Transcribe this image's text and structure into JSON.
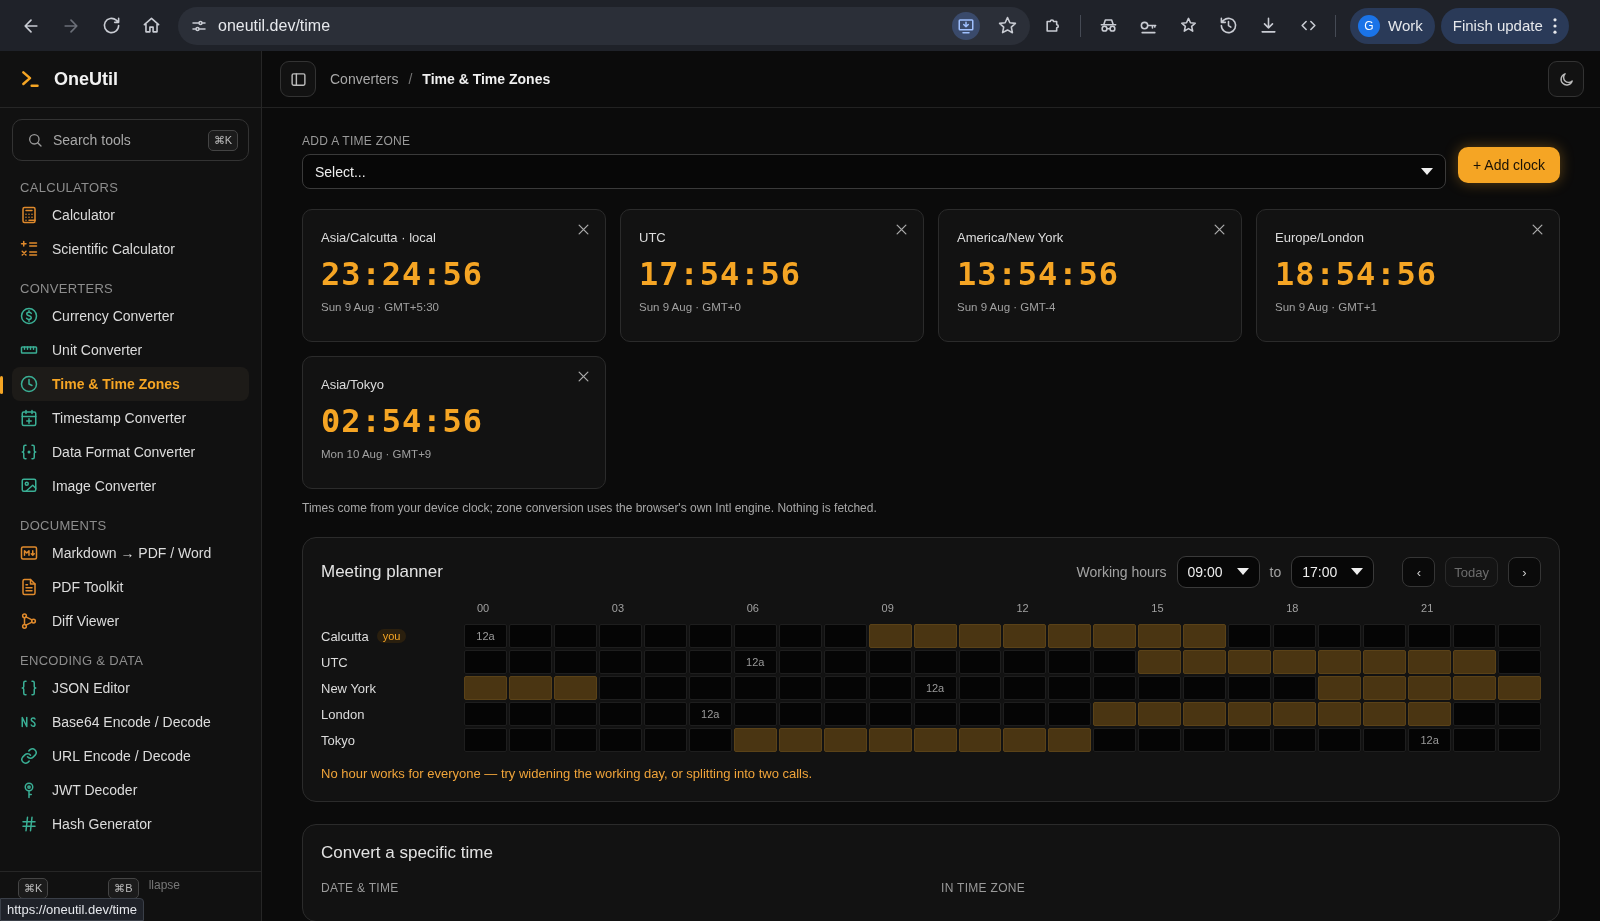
{
  "browser": {
    "url": "oneutil.dev/time",
    "profile": {
      "initial": "G",
      "name": "Work"
    },
    "update_button": "Finish update"
  },
  "sidebar": {
    "app_name": "OneUtil",
    "search": {
      "placeholder": "Search tools",
      "shortcut": "⌘K"
    },
    "sections": [
      {
        "title": "CALCULATORS",
        "items": [
          {
            "label": "Calculator",
            "selected": false
          },
          {
            "label": "Scientific Calculator",
            "selected": false
          }
        ]
      },
      {
        "title": "CONVERTERS",
        "items": [
          {
            "label": "Currency Converter",
            "selected": false
          },
          {
            "label": "Unit Converter",
            "selected": false
          },
          {
            "label": "Time & Time Zones",
            "selected": true
          },
          {
            "label": "Timestamp Converter",
            "selected": false
          },
          {
            "label": "Data Format Converter",
            "selected": false
          },
          {
            "label": "Image Converter",
            "selected": false
          }
        ]
      },
      {
        "title": "DOCUMENTS",
        "items": [
          {
            "label": "Markdown → PDF / Word",
            "selected": false
          },
          {
            "label": "PDF Toolkit",
            "selected": false
          },
          {
            "label": "Diff Viewer",
            "selected": false
          }
        ]
      },
      {
        "title": "ENCODING & DATA",
        "items": [
          {
            "label": "JSON Editor",
            "selected": false
          },
          {
            "label": "Base64 Encode / Decode",
            "selected": false
          },
          {
            "label": "URL Encode / Decode",
            "selected": false
          },
          {
            "label": "JWT Decoder",
            "selected": false
          },
          {
            "label": "Hash Generator",
            "selected": false
          }
        ]
      }
    ],
    "footer": {
      "keys": [
        "⌘K",
        "⌘B"
      ],
      "text": "llapse"
    }
  },
  "breadcrumb": {
    "items": [
      "Converters",
      "Time & Time Zones"
    ],
    "separator": "/"
  },
  "add_zone": {
    "label": "ADD A TIME ZONE",
    "value": "Select...",
    "button": "+ Add clock"
  },
  "clocks": [
    {
      "zone": "Asia/Calcutta · local",
      "time": "23:24:56",
      "date": "Sun 9 Aug · GMT+5:30"
    },
    {
      "zone": "UTC",
      "time": "17:54:56",
      "date": "Sun 9 Aug · GMT+0"
    },
    {
      "zone": "America/New York",
      "time": "13:54:56",
      "date": "Sun 9 Aug · GMT-4"
    },
    {
      "zone": "Europe/London",
      "time": "18:54:56",
      "date": "Sun 9 Aug · GMT+1"
    },
    {
      "zone": "Asia/Tokyo",
      "time": "02:54:56",
      "date": "Mon 10 Aug · GMT+9"
    }
  ],
  "note": "Times come from your device clock; zone conversion uses the browser's own Intl engine. Nothing is fetched.",
  "planner": {
    "title": "Meeting planner",
    "hours_label": "Working hours",
    "start": "09:00",
    "to": "to",
    "end": "17:00",
    "nav": [
      {
        "label": "‹",
        "disabled": false
      },
      {
        "label": "Today",
        "disabled": true
      },
      {
        "label": "›",
        "disabled": false
      }
    ],
    "hour_ticks": [
      "00",
      "03",
      "06",
      "09",
      "12",
      "15",
      "18",
      "21"
    ],
    "rows": [
      {
        "name": "Calcutta",
        "badge": "you",
        "cells": [
          {
            "working": false,
            "label": "12a"
          },
          {
            "working": false
          },
          {
            "working": false
          },
          {
            "working": false
          },
          {
            "working": false
          },
          {
            "working": false
          },
          {
            "working": false
          },
          {
            "working": false
          },
          {
            "working": false
          },
          {
            "working": true
          },
          {
            "working": true
          },
          {
            "working": true
          },
          {
            "working": true
          },
          {
            "working": true
          },
          {
            "working": true
          },
          {
            "working": true
          },
          {
            "working": true
          },
          {
            "working": false
          },
          {
            "working": false
          },
          {
            "working": false
          },
          {
            "working": false
          },
          {
            "working": false
          },
          {
            "working": false
          },
          {
            "working": false
          }
        ]
      },
      {
        "name": "UTC",
        "cells": [
          {
            "working": false
          },
          {
            "working": false
          },
          {
            "working": false
          },
          {
            "working": false
          },
          {
            "working": false
          },
          {
            "working": false
          },
          {
            "working": false,
            "label": "12a"
          },
          {
            "working": false
          },
          {
            "working": false
          },
          {
            "working": false
          },
          {
            "working": false
          },
          {
            "working": false
          },
          {
            "working": false
          },
          {
            "working": false
          },
          {
            "working": false
          },
          {
            "working": true
          },
          {
            "working": true
          },
          {
            "working": true
          },
          {
            "working": true
          },
          {
            "working": true
          },
          {
            "working": true
          },
          {
            "working": true
          },
          {
            "working": true
          },
          {
            "working": false
          }
        ]
      },
      {
        "name": "New York",
        "cells": [
          {
            "working": true
          },
          {
            "working": true
          },
          {
            "working": true
          },
          {
            "working": false
          },
          {
            "working": false
          },
          {
            "working": false
          },
          {
            "working": false
          },
          {
            "working": false
          },
          {
            "working": false
          },
          {
            "working": false
          },
          {
            "working": false,
            "label": "12a"
          },
          {
            "working": false
          },
          {
            "working": false
          },
          {
            "working": false
          },
          {
            "working": false
          },
          {
            "working": false
          },
          {
            "working": false
          },
          {
            "working": false
          },
          {
            "working": false
          },
          {
            "working": true
          },
          {
            "working": true
          },
          {
            "working": true
          },
          {
            "working": true
          },
          {
            "working": true
          }
        ]
      },
      {
        "name": "London",
        "cells": [
          {
            "working": false
          },
          {
            "working": false
          },
          {
            "working": false
          },
          {
            "working": false
          },
          {
            "working": false
          },
          {
            "working": false,
            "label": "12a"
          },
          {
            "working": false
          },
          {
            "working": false
          },
          {
            "working": false
          },
          {
            "working": false
          },
          {
            "working": false
          },
          {
            "working": false
          },
          {
            "working": false
          },
          {
            "working": false
          },
          {
            "working": true
          },
          {
            "working": true
          },
          {
            "working": true
          },
          {
            "working": true
          },
          {
            "working": true
          },
          {
            "working": true
          },
          {
            "working": true
          },
          {
            "working": true
          },
          {
            "working": false
          },
          {
            "working": false
          }
        ]
      },
      {
        "name": "Tokyo",
        "cells": [
          {
            "working": false
          },
          {
            "working": false
          },
          {
            "working": false
          },
          {
            "working": false
          },
          {
            "working": false
          },
          {
            "working": false
          },
          {
            "working": true
          },
          {
            "working": true
          },
          {
            "working": true
          },
          {
            "working": true
          },
          {
            "working": true
          },
          {
            "working": true
          },
          {
            "working": true
          },
          {
            "working": true
          },
          {
            "working": false
          },
          {
            "working": false
          },
          {
            "working": false
          },
          {
            "working": false
          },
          {
            "working": false
          },
          {
            "working": false
          },
          {
            "working": false
          },
          {
            "working": false,
            "label": "12a"
          },
          {
            "working": false
          },
          {
            "working": false
          }
        ]
      }
    ],
    "message": "No hour works for everyone — try widening the working day, or splitting into two calls."
  },
  "convert": {
    "title": "Convert a specific time",
    "fields": [
      "DATE & TIME",
      "IN TIME ZONE"
    ]
  },
  "status_url": "https://oneutil.dev/time"
}
